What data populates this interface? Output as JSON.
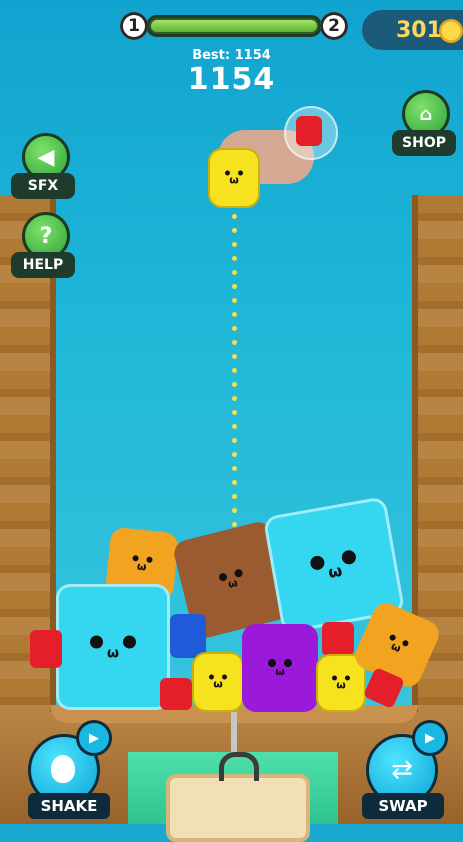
{
  "level": {
    "current": "1",
    "next": "2",
    "progress": 1.0
  },
  "coins": {
    "value": "301"
  },
  "best": {
    "label": "Best: 1154"
  },
  "score": {
    "value": "1154"
  },
  "side_buttons": {
    "sfx": {
      "label": "SFX",
      "icon": "speaker-icon"
    },
    "help": {
      "label": "HELP",
      "icon": "question-icon"
    },
    "shop": {
      "label": "SHOP",
      "icon": "shop-icon"
    }
  },
  "actions": {
    "shake": {
      "label": "SHAKE",
      "icon": "strawberry-icon"
    },
    "swap": {
      "label": "SWAP",
      "icon": "swap-arrows-icon"
    }
  },
  "colors": {
    "yellow": "#f7e21f",
    "cyan": "#35d6f0",
    "orange": "#f2a421",
    "brown": "#9a5b30",
    "purple": "#9b19d8",
    "red": "#e51f2a",
    "blue": "#1f5bd9"
  }
}
